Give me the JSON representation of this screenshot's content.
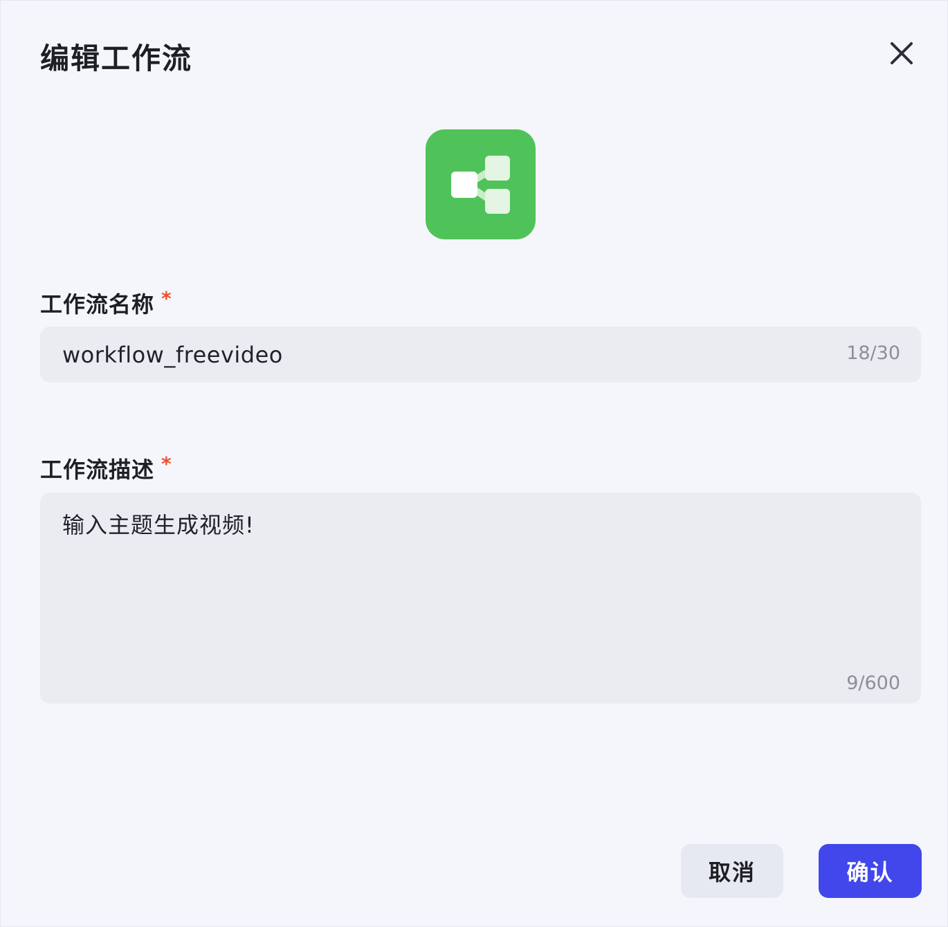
{
  "dialog": {
    "title": "编辑工作流",
    "close_icon": "close-icon",
    "app_icon": "workflow-icon",
    "app_icon_color": "#4fc25a"
  },
  "fields": {
    "name": {
      "label": "工作流名称",
      "required_mark": "*",
      "value": "workflow_freevideo",
      "counter": "18/30"
    },
    "description": {
      "label": "工作流描述",
      "required_mark": "*",
      "value": "输入主题生成视频!",
      "counter": "9/600"
    }
  },
  "buttons": {
    "cancel_label": "取消",
    "confirm_label": "确认",
    "confirm_color": "#4147eb"
  }
}
